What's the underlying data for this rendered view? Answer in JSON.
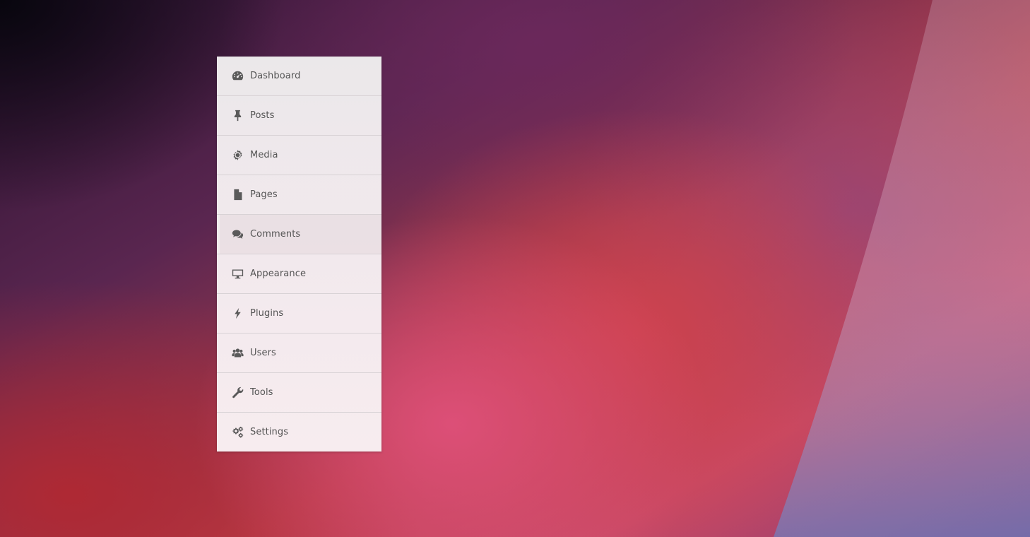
{
  "colors": {
    "menu_background": "#f2e9ed",
    "menu_divider": "#d8d2d5",
    "text": "#555555",
    "icon": "#5a5a5a"
  },
  "menu": {
    "items": [
      {
        "label": "Dashboard",
        "icon": "dashboard-gauge-icon"
      },
      {
        "label": "Posts",
        "icon": "pushpin-icon"
      },
      {
        "label": "Media",
        "icon": "media-camera-icon"
      },
      {
        "label": "Pages",
        "icon": "page-document-icon"
      },
      {
        "label": "Comments",
        "icon": "comments-bubbles-icon"
      },
      {
        "label": "Appearance",
        "icon": "monitor-icon"
      },
      {
        "label": "Plugins",
        "icon": "lightning-bolt-icon"
      },
      {
        "label": "Users",
        "icon": "users-group-icon"
      },
      {
        "label": "Tools",
        "icon": "wrench-icon"
      },
      {
        "label": "Settings",
        "icon": "gears-icon"
      }
    ]
  }
}
